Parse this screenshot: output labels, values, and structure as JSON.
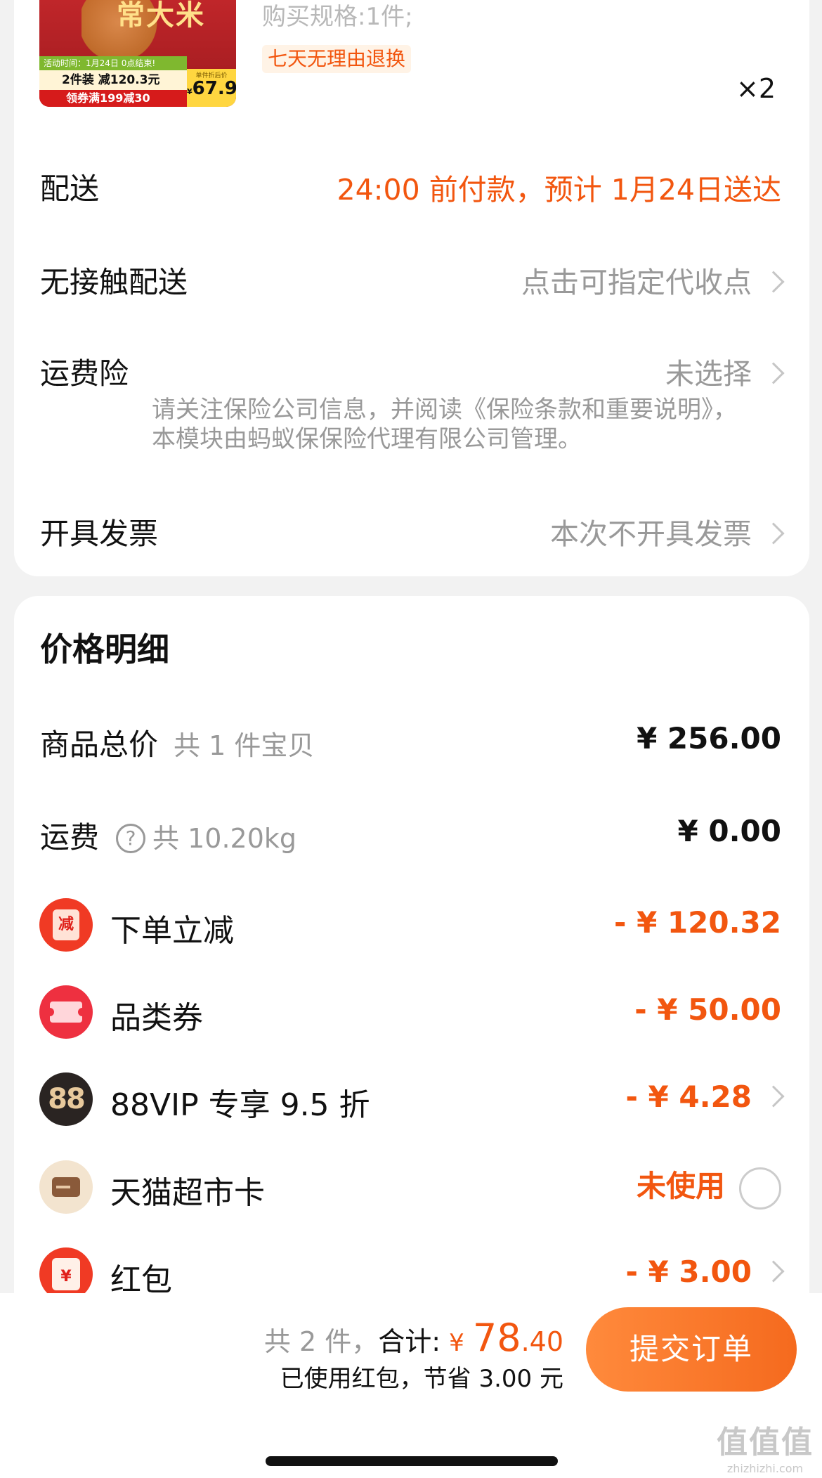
{
  "product": {
    "thumb_headline": "常大米",
    "thumb_promo": "活动时间：1月24日 0点结束!",
    "thumb_pack": "2件装 减120.3元",
    "thumb_coupon": "领券满199减30",
    "thumb_price_label": "单件折后价",
    "thumb_currency": "¥",
    "thumb_price": "67.9",
    "spec": "购买规格:1件;",
    "return_badge": "七天无理由退换",
    "quantity": "×2"
  },
  "rows": {
    "delivery_label": "配送",
    "delivery_value": "24:00 前付款，预计 1月24日送达",
    "contactless_label": "无接触配送",
    "contactless_value": "点击可指定代收点",
    "insurance_label": "运费险",
    "insurance_value": "未选择",
    "insurance_note": "请关注保险公司信息，并阅读《保险条款和重要说明》，本模块由蚂蚁保保险代理有限公司管理。",
    "invoice_label": "开具发票",
    "invoice_value": "本次不开具发票"
  },
  "price_detail": {
    "title": "价格明细",
    "total_label": "商品总价",
    "total_sub": "共 1 件宝贝",
    "total_value": "¥ 256.00",
    "shipping_label": "运费",
    "shipping_help": "?",
    "shipping_sub": "共 10.20kg",
    "shipping_value": "¥ 0.00",
    "items": [
      {
        "icon": "reduce-icon",
        "icon_text": "减",
        "label": "下单立减",
        "value": "- ¥ 120.32"
      },
      {
        "icon": "coupon-icon",
        "label": "品类券",
        "value": "- ¥ 50.00"
      },
      {
        "icon": "88vip-icon",
        "icon_text": "88",
        "label": "88VIP 专享 9.5 折",
        "value": "- ¥ 4.28"
      },
      {
        "icon": "card-icon",
        "label": "天猫超市卡",
        "value": "未使用"
      },
      {
        "icon": "red-envelope-icon",
        "icon_text": "¥",
        "label": "红包",
        "value": "- ¥ 3.00"
      }
    ]
  },
  "bottom": {
    "count": "共 2 件，",
    "total_label": "合计:",
    "currency": "¥",
    "amount_int": "78",
    "amount_dec": ".40",
    "saving": "已使用红包，节省 3.00 元",
    "submit": "提交订单"
  },
  "watermark": {
    "glyphs": "值值值",
    "url": "zhizhizhi.com"
  },
  "colors": {
    "accent": "#f2560f",
    "background": "#f2f2f2",
    "submit_gradient_start": "#ff8a3c",
    "submit_gradient_end": "#f56a1e"
  }
}
